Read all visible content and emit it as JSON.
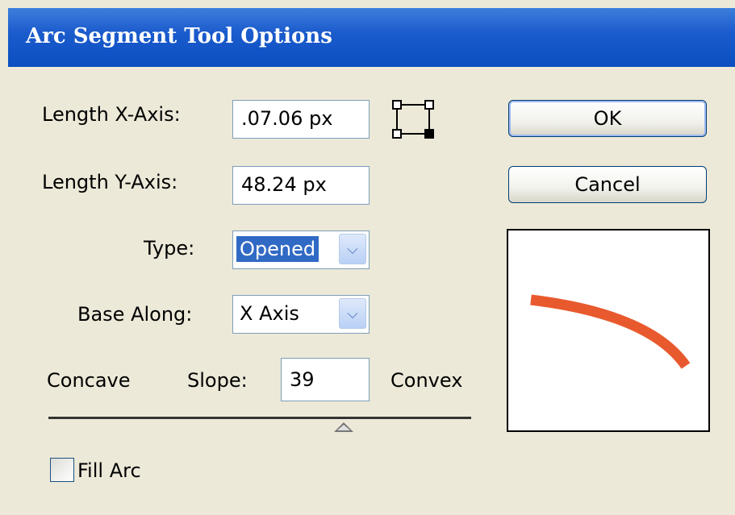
{
  "window": {
    "title": "Arc Segment Tool Options"
  },
  "fields": {
    "length_x": {
      "label": "Length X-Axis:",
      "value": ".07.06 px"
    },
    "length_y": {
      "label": "Length Y-Axis:",
      "value": "48.24 px"
    },
    "type": {
      "label": "Type:",
      "value": "Opened"
    },
    "base_along": {
      "label": "Base Along:",
      "value": "X Axis"
    },
    "slope": {
      "label": "Slope:",
      "value": "39",
      "left_label": "Concave",
      "right_label": "Convex"
    }
  },
  "fill_arc": {
    "label": "Fill Arc",
    "checked": false
  },
  "buttons": {
    "ok": "OK",
    "cancel": "Cancel"
  },
  "icons": {
    "reference_point": "reference-point-locator-icon",
    "dropdown": "chevron-down-icon"
  },
  "colors": {
    "arc_stroke": "#e85a2e",
    "title_bar": "#0a4ec0",
    "selection": "#316ac5"
  }
}
